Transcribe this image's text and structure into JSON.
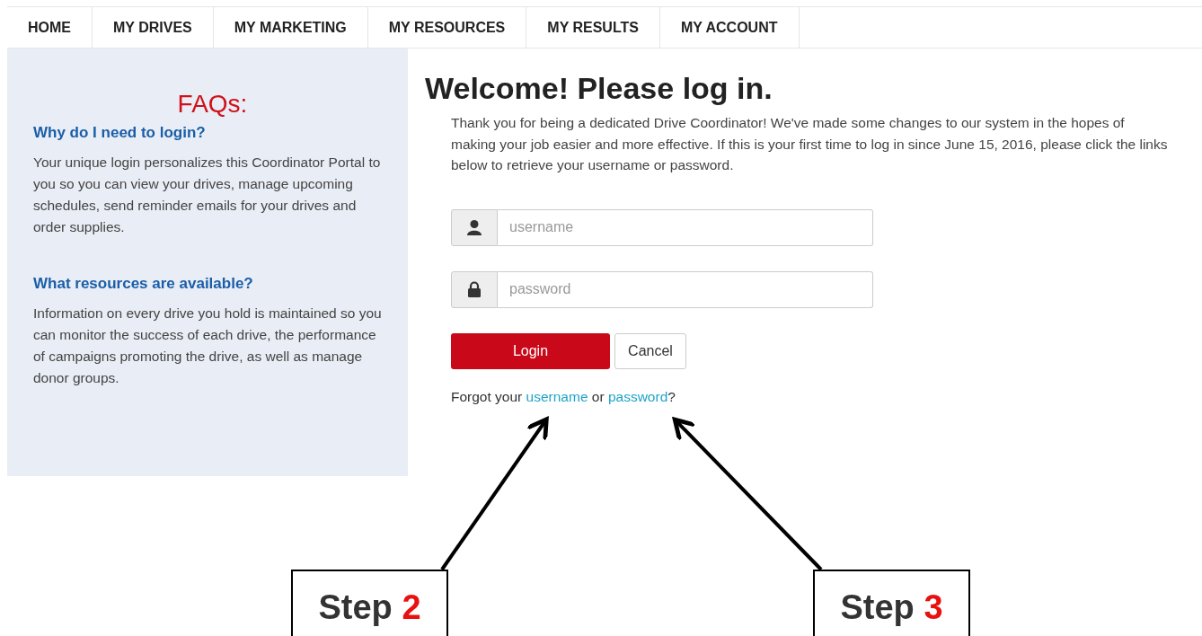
{
  "nav": [
    {
      "label": "HOME"
    },
    {
      "label": "MY DRIVES"
    },
    {
      "label": "MY MARKETING"
    },
    {
      "label": "MY RESOURCES"
    },
    {
      "label": "MY RESULTS"
    },
    {
      "label": "MY ACCOUNT"
    }
  ],
  "faq": {
    "title": "FAQs:",
    "items": [
      {
        "question": "Why do I need to login?",
        "answer": "Your unique login personalizes this Coordinator Portal to you so you can view your drives, manage upcoming schedules, send reminder emails for your drives and order supplies."
      },
      {
        "question": "What resources are available?",
        "answer": "Information on every drive you hold is maintained so you can monitor the success of each drive, the performance of campaigns promoting the drive, as well as manage donor groups."
      }
    ]
  },
  "login": {
    "heading": "Welcome! Please log in.",
    "intro": "Thank you for being a dedicated Drive Coordinator! We've made some changes to our system in the hopes of making your job easier and more effective. If this is your first time to log in since June 15, 2016, please click the links below to retrieve your username or password.",
    "fields": [
      {
        "kind": "user",
        "placeholder": "username"
      },
      {
        "kind": "lock",
        "placeholder": "password"
      }
    ],
    "buttons": [
      {
        "kind": "primary",
        "label": "Login"
      },
      {
        "kind": "secondary",
        "label": "Cancel"
      }
    ],
    "forgot": {
      "prefix": "Forgot your",
      "links": [
        "username",
        "password"
      ],
      "joiner": "or",
      "suffix": "?"
    }
  },
  "callouts": [
    {
      "label": "Step",
      "number": "2"
    },
    {
      "label": "Step",
      "number": "3"
    }
  ]
}
